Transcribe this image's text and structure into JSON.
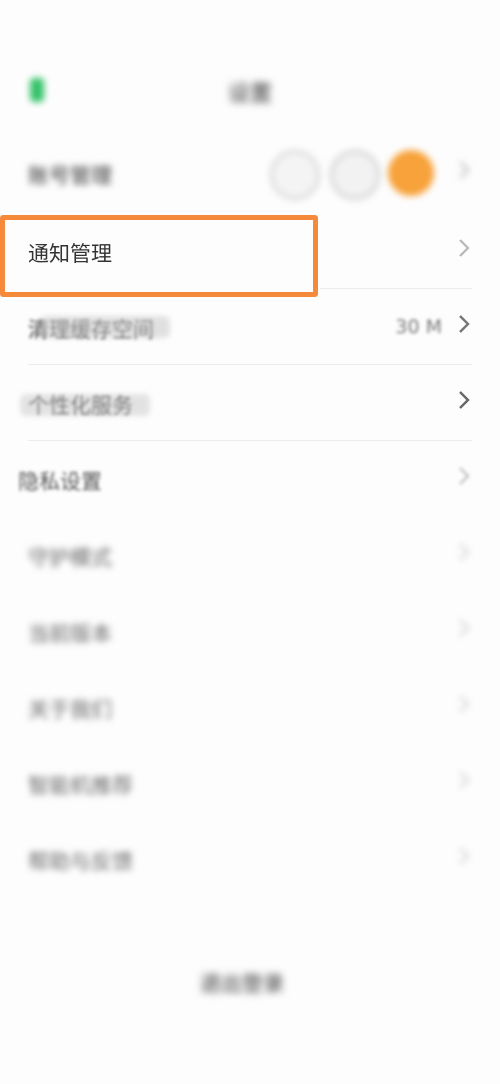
{
  "status_bar": {
    "time": "",
    "right": ""
  },
  "header": {
    "title": "设置"
  },
  "rows": [
    {
      "label": "账号管理",
      "value": ""
    },
    {
      "label": "通知管理",
      "value": ""
    },
    {
      "label": "清理缓存空间",
      "value": "30 M"
    },
    {
      "label": "个性化服务",
      "value": ""
    },
    {
      "label": "隐私设置",
      "value": ""
    },
    {
      "label": "守护模式",
      "value": ""
    },
    {
      "label": "当前版本",
      "value": ""
    },
    {
      "label": "关于我们",
      "value": ""
    },
    {
      "label": "智能机推荐",
      "value": ""
    },
    {
      "label": "帮助与反馈",
      "value": ""
    }
  ],
  "footer": {
    "logout_label": "退出登录"
  },
  "colors": {
    "accent_orange": "#f48a3a",
    "avatar_orange": "#f7a23a",
    "back_green": "#35c36a"
  },
  "icons": {
    "back": "back-icon",
    "chevron": "chevron-right-icon"
  }
}
